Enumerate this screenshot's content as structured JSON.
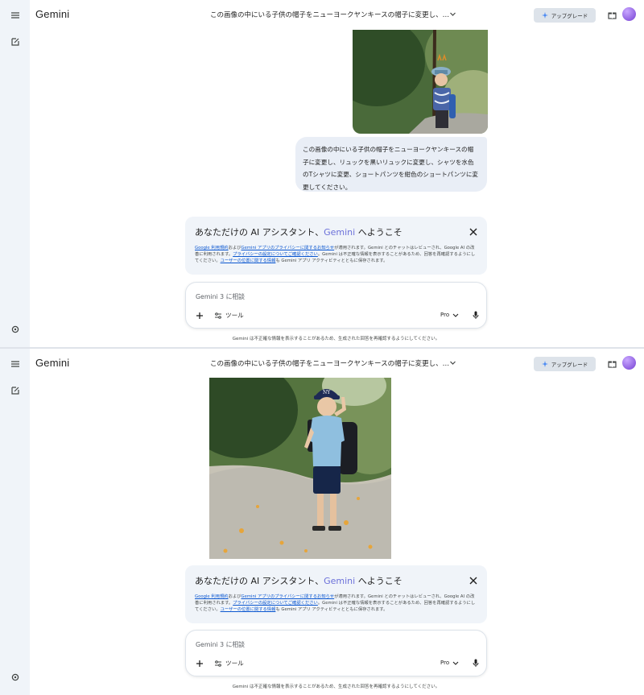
{
  "app": {
    "name": "Gemini"
  },
  "header": {
    "conversation_title": "この画像の中にいる子供の帽子をニューヨークヤンキースの帽子に変更し、リュ...",
    "upgrade_label": "アップグレード"
  },
  "user_message": "この画像の中にいる子供の帽子をニューヨークヤンキースの帽子に変更し、リュックを黒いリュックに変更し、シャツを水色のTシャツに変更、ショートパンツを紺色のショートパンツに変更してください。",
  "welcome": {
    "title_prefix": "あなただけの AI アシスタント、",
    "title_brand": "Gemini",
    "title_suffix": " へようこそ",
    "legal": {
      "link_terms": "Google 利用規約",
      "text_1": "および",
      "link_privacy_notice": "Gemini アプリのプライバシーに関するお知らせ",
      "text_2": "が適用されます。Gemini とのチャットはレビューされ、Google AI の改善に利用されます。",
      "link_privacy_settings": "プライバシーの設定についてご確認ください",
      "text_3": "。Gemini は不正確な情報を表示することがあるため、回答を再確認するようにしてください。",
      "link_location": "ユーザーの位置に関する情報",
      "text_4": "も Gemini アプリ アクティビティとともに保存されます。"
    }
  },
  "composer": {
    "placeholder": "Gemini 3 に相談",
    "tools_label": "ツール",
    "model_label": "Pro"
  },
  "disclaimer": "Gemini は不正確な情報を表示することがあるため、生成された回答を再確認するようにしてください。",
  "colors": {
    "sidebar_bg": "#f0f4f9",
    "bubble_bg": "#e9eef6",
    "link": "#0b57d0",
    "brand_text": "#6b70d9"
  },
  "icons": [
    "menu-icon",
    "new-chat-icon",
    "settings-icon",
    "chevron-down-icon",
    "sparkle-icon",
    "gift-icon",
    "avatar",
    "close-icon",
    "plus-icon",
    "tools-icon",
    "mic-icon"
  ]
}
